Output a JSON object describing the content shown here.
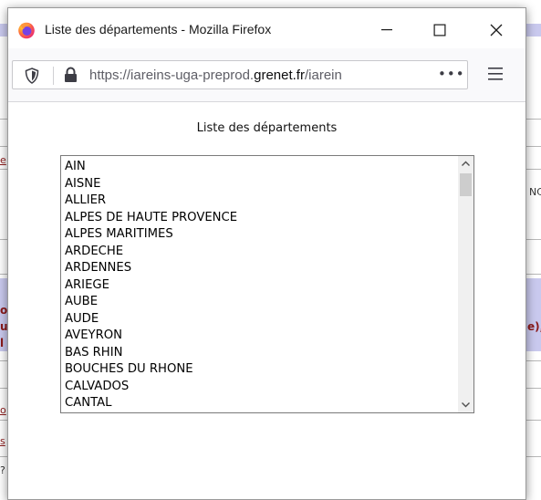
{
  "window": {
    "title": "Liste des départements - Mozilla Firefox"
  },
  "urlbar": {
    "prefix": "https://iareins-uga-preprod.",
    "domain": "grenet.fr",
    "suffix": "/iarein",
    "more": "•••"
  },
  "page": {
    "heading": "Liste des départements",
    "departements": [
      "AIN",
      "AISNE",
      "ALLIER",
      "ALPES DE HAUTE PROVENCE",
      "ALPES MARITIMES",
      "ARDECHE",
      "ARDENNES",
      "ARIEGE",
      "AUBE",
      "AUDE",
      "AVEYRON",
      "BAS RHIN",
      "BOUCHES DU RHONE",
      "CALVADOS",
      "CANTAL"
    ]
  },
  "background": {
    "frag_left_1": "e",
    "frag_right_1": "NC",
    "frag_left_2": "ol",
    "frag_left_3": "u",
    "frag_left_4": "l",
    "frag_right_2": "e),",
    "frag_left_5": "o",
    "frag_left_6": "s",
    "frag_left_7": "?"
  },
  "colors": {
    "band": "#c9c9ee",
    "link_red": "#8b1a1a"
  }
}
